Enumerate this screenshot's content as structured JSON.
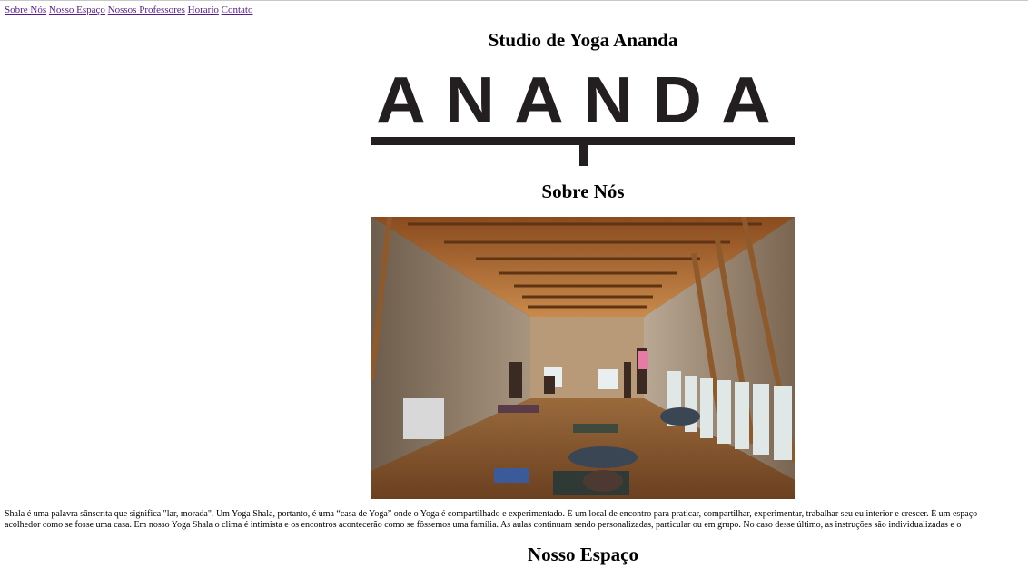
{
  "nav": {
    "items": [
      {
        "label": "Sobre Nós"
      },
      {
        "label": "Nosso Espaço"
      },
      {
        "label": "Nossos Professores"
      },
      {
        "label": "Horario"
      },
      {
        "label": "Contato"
      }
    ]
  },
  "header": {
    "title": "Studio de Yoga Ananda",
    "logo_text": "ANANDA"
  },
  "sections": {
    "about": {
      "title": "Sobre Nós",
      "text_line_1": "Shala é uma palavra sânscrita que significa \"lar, morada\". Um Yoga Shala, portanto, é uma “casa de Yoga” onde o Yoga é compartilhado e experimentado. É um local de encontro para praticar, compartilhar, experimentar, trabalhar seu eu interior e crescer. É um espaço",
      "text_line_2": "acolhedor como se fosse uma casa. Em nosso Yoga Shala o clima é intimista e os encontros acontecerão como se fôssemos uma família. As aulas continuam sendo personalizadas, particular ou em grupo. No caso desse último, as instruções são individualizadas e o"
    },
    "space": {
      "title": "Nosso Espaço"
    }
  },
  "colors": {
    "link": "#551a8b",
    "logo": "#231f20",
    "text": "#000000",
    "background": "#ffffff"
  }
}
